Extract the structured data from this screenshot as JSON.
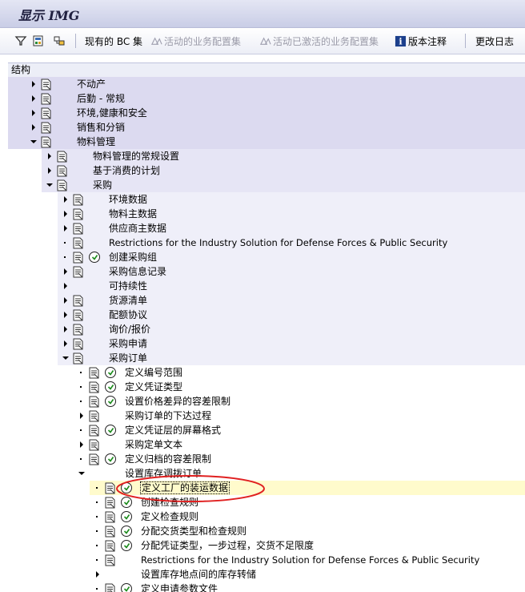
{
  "window": {
    "title": "显示 IMG"
  },
  "toolbar": {
    "items": [
      {
        "label": "现有的 BC 集",
        "enabled": true
      },
      {
        "label": "活动的业务配置集",
        "enabled": false
      },
      {
        "label": "活动已激活的业务配置集",
        "enabled": false
      },
      {
        "label": "版本注释",
        "enabled": true
      },
      {
        "label": "更改日志",
        "enabled": true
      }
    ]
  },
  "structure": {
    "header": "结构"
  },
  "tree": [
    {
      "label": "不动产",
      "level": 0,
      "toggle": "collapsed",
      "doc": true,
      "activity": false
    },
    {
      "label": "后勤 - 常规",
      "level": 0,
      "toggle": "collapsed",
      "doc": true,
      "activity": false
    },
    {
      "label": "环境,健康和安全",
      "level": 0,
      "toggle": "collapsed",
      "doc": true,
      "activity": false
    },
    {
      "label": "销售和分销",
      "level": 0,
      "toggle": "collapsed",
      "doc": true,
      "activity": false
    },
    {
      "label": "物料管理",
      "level": 0,
      "toggle": "expanded",
      "doc": true,
      "activity": false
    },
    {
      "label": "物料管理的常规设置",
      "level": 1,
      "toggle": "collapsed",
      "doc": true,
      "activity": false
    },
    {
      "label": "基于消费的计划",
      "level": 1,
      "toggle": "collapsed",
      "doc": true,
      "activity": false
    },
    {
      "label": "采购",
      "level": 1,
      "toggle": "expanded",
      "doc": true,
      "activity": false
    },
    {
      "label": "环境数据",
      "level": 2,
      "toggle": "collapsed",
      "doc": true,
      "activity": false
    },
    {
      "label": "物料主数据",
      "level": 2,
      "toggle": "collapsed",
      "doc": true,
      "activity": false
    },
    {
      "label": "供应商主数据",
      "level": 2,
      "toggle": "collapsed",
      "doc": true,
      "activity": false
    },
    {
      "label": "Restrictions for the Industry Solution for Defense Forces & Public Security",
      "level": 2,
      "toggle": "leaf",
      "doc": true,
      "activity": false
    },
    {
      "label": "创建采购组",
      "level": 2,
      "toggle": "leaf",
      "doc": true,
      "activity": true
    },
    {
      "label": "采购信息记录",
      "level": 2,
      "toggle": "collapsed",
      "doc": true,
      "activity": false
    },
    {
      "label": "可持续性",
      "level": 2,
      "toggle": "collapsed",
      "doc": false,
      "activity": false
    },
    {
      "label": "货源清单",
      "level": 2,
      "toggle": "collapsed",
      "doc": true,
      "activity": false
    },
    {
      "label": "配额协议",
      "level": 2,
      "toggle": "collapsed",
      "doc": true,
      "activity": false
    },
    {
      "label": "询价/报价",
      "level": 2,
      "toggle": "collapsed",
      "doc": true,
      "activity": false
    },
    {
      "label": "采购申请",
      "level": 2,
      "toggle": "collapsed",
      "doc": true,
      "activity": false
    },
    {
      "label": "采购订单",
      "level": 2,
      "toggle": "expanded",
      "doc": true,
      "activity": false
    },
    {
      "label": "定义编号范围",
      "level": 3,
      "toggle": "leaf",
      "doc": true,
      "activity": true
    },
    {
      "label": "定义凭证类型",
      "level": 3,
      "toggle": "leaf",
      "doc": true,
      "activity": true
    },
    {
      "label": "设置价格差异的容差限制",
      "level": 3,
      "toggle": "leaf",
      "doc": true,
      "activity": true
    },
    {
      "label": "采购订单的下达过程",
      "level": 3,
      "toggle": "collapsed",
      "doc": true,
      "activity": false
    },
    {
      "label": "定义凭证层的屏幕格式",
      "level": 3,
      "toggle": "leaf",
      "doc": true,
      "activity": true
    },
    {
      "label": "采购定单文本",
      "level": 3,
      "toggle": "collapsed",
      "doc": true,
      "activity": false
    },
    {
      "label": "定义归档的容差限制",
      "level": 3,
      "toggle": "leaf",
      "doc": true,
      "activity": true
    },
    {
      "label": "设置库存调拨订单",
      "level": 3,
      "toggle": "expanded",
      "doc": false,
      "activity": false
    },
    {
      "label": "定义工厂的装运数据",
      "level": 4,
      "toggle": "leaf",
      "doc": true,
      "activity": true,
      "selected": true
    },
    {
      "label": "创建检查规则",
      "level": 4,
      "toggle": "leaf",
      "doc": true,
      "activity": true
    },
    {
      "label": "定义检查规则",
      "level": 4,
      "toggle": "leaf",
      "doc": true,
      "activity": true
    },
    {
      "label": "分配交货类型和检查规则",
      "level": 4,
      "toggle": "leaf",
      "doc": true,
      "activity": true
    },
    {
      "label": "分配凭证类型，一步过程，交货不足限度",
      "level": 4,
      "toggle": "leaf",
      "doc": true,
      "activity": true
    },
    {
      "label": "Restrictions for the Industry Solution for Defense Forces & Public Security",
      "level": 4,
      "toggle": "leaf",
      "doc": true,
      "activity": false
    },
    {
      "label": "设置库存地点间的库存转储",
      "level": 4,
      "toggle": "collapsed",
      "doc": false,
      "activity": false
    },
    {
      "label": "定义申请参数文件",
      "level": 4,
      "toggle": "leaf",
      "doc": true,
      "activity": true
    }
  ]
}
